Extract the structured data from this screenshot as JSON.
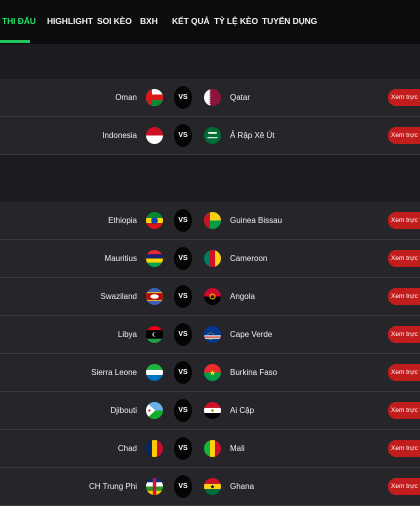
{
  "nav": {
    "tabs": [
      {
        "label": "THI ĐẤU",
        "active": true
      },
      {
        "label": "HIGHLIGHT"
      },
      {
        "label": "SOI KÈO"
      },
      {
        "label": "BXH"
      },
      {
        "label": "KẾT QUẢ"
      },
      {
        "label": "TỶ LỆ KÈO"
      },
      {
        "label": "TUYỂN DỤNG"
      }
    ]
  },
  "vs_label": "VS",
  "live_button_label": "Xem trực tiếp",
  "groups": [
    {
      "matches": [
        {
          "home": "Oman",
          "away": "Qatar"
        },
        {
          "home": "Indonesia",
          "away": "Ả Rập Xê Út"
        }
      ]
    },
    {
      "matches": [
        {
          "home": "Ethiopia",
          "away": "Guinea Bissau"
        },
        {
          "home": "Mauritius",
          "away": "Cameroon"
        },
        {
          "home": "Swaziland",
          "away": "Angola"
        },
        {
          "home": "Libya",
          "away": "Cape Verde"
        },
        {
          "home": "Sierra Leone",
          "away": "Burkina Faso"
        },
        {
          "home": "Djibouti",
          "away": "Ai Cập"
        },
        {
          "home": "Chad",
          "away": "Mali"
        },
        {
          "home": "CH Trung Phi",
          "away": "Ghana"
        }
      ]
    }
  ],
  "colors": {
    "accent": "#22c55e",
    "live_button": "#c21d1d",
    "background": "#26262a",
    "nav": "#0d0d0f"
  }
}
